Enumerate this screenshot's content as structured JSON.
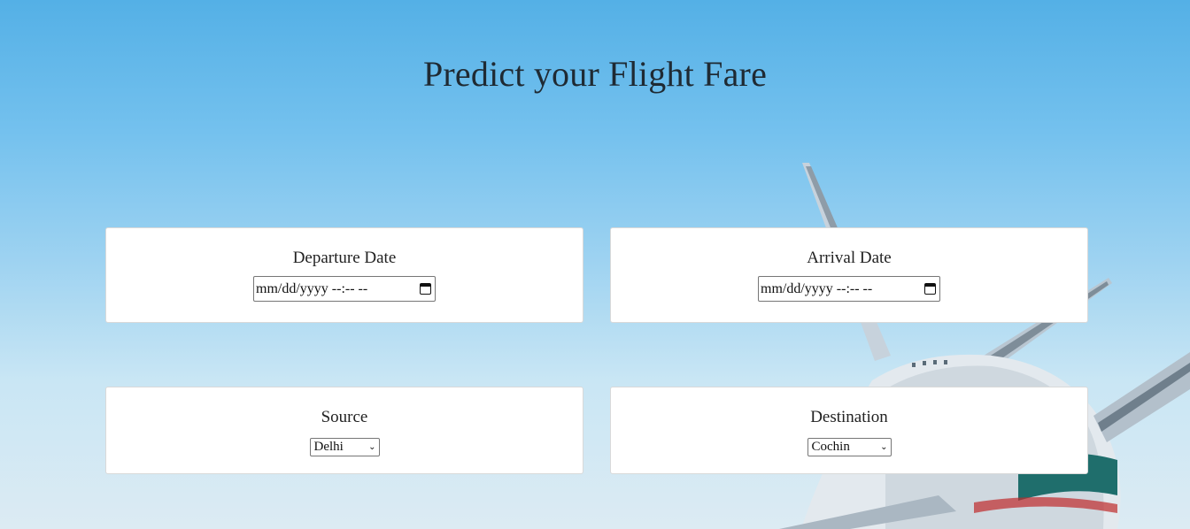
{
  "page": {
    "title": "Predict your Flight Fare"
  },
  "form": {
    "departure": {
      "label": "Departure Date",
      "placeholder": "mm/dd/yyyy --:-- --"
    },
    "arrival": {
      "label": "Arrival Date",
      "placeholder": "mm/dd/yyyy --:-- --"
    },
    "source": {
      "label": "Source",
      "selected": "Delhi"
    },
    "destination": {
      "label": "Destination",
      "selected": "Cochin"
    }
  },
  "icons": {
    "calendar": "calendar-icon",
    "dropdown": "chevron-down-icon"
  },
  "colors": {
    "sky_top": "#54b0e6",
    "sky_bottom": "#dcebf3",
    "card_background": "#ffffff",
    "text": "#1f2a33"
  }
}
